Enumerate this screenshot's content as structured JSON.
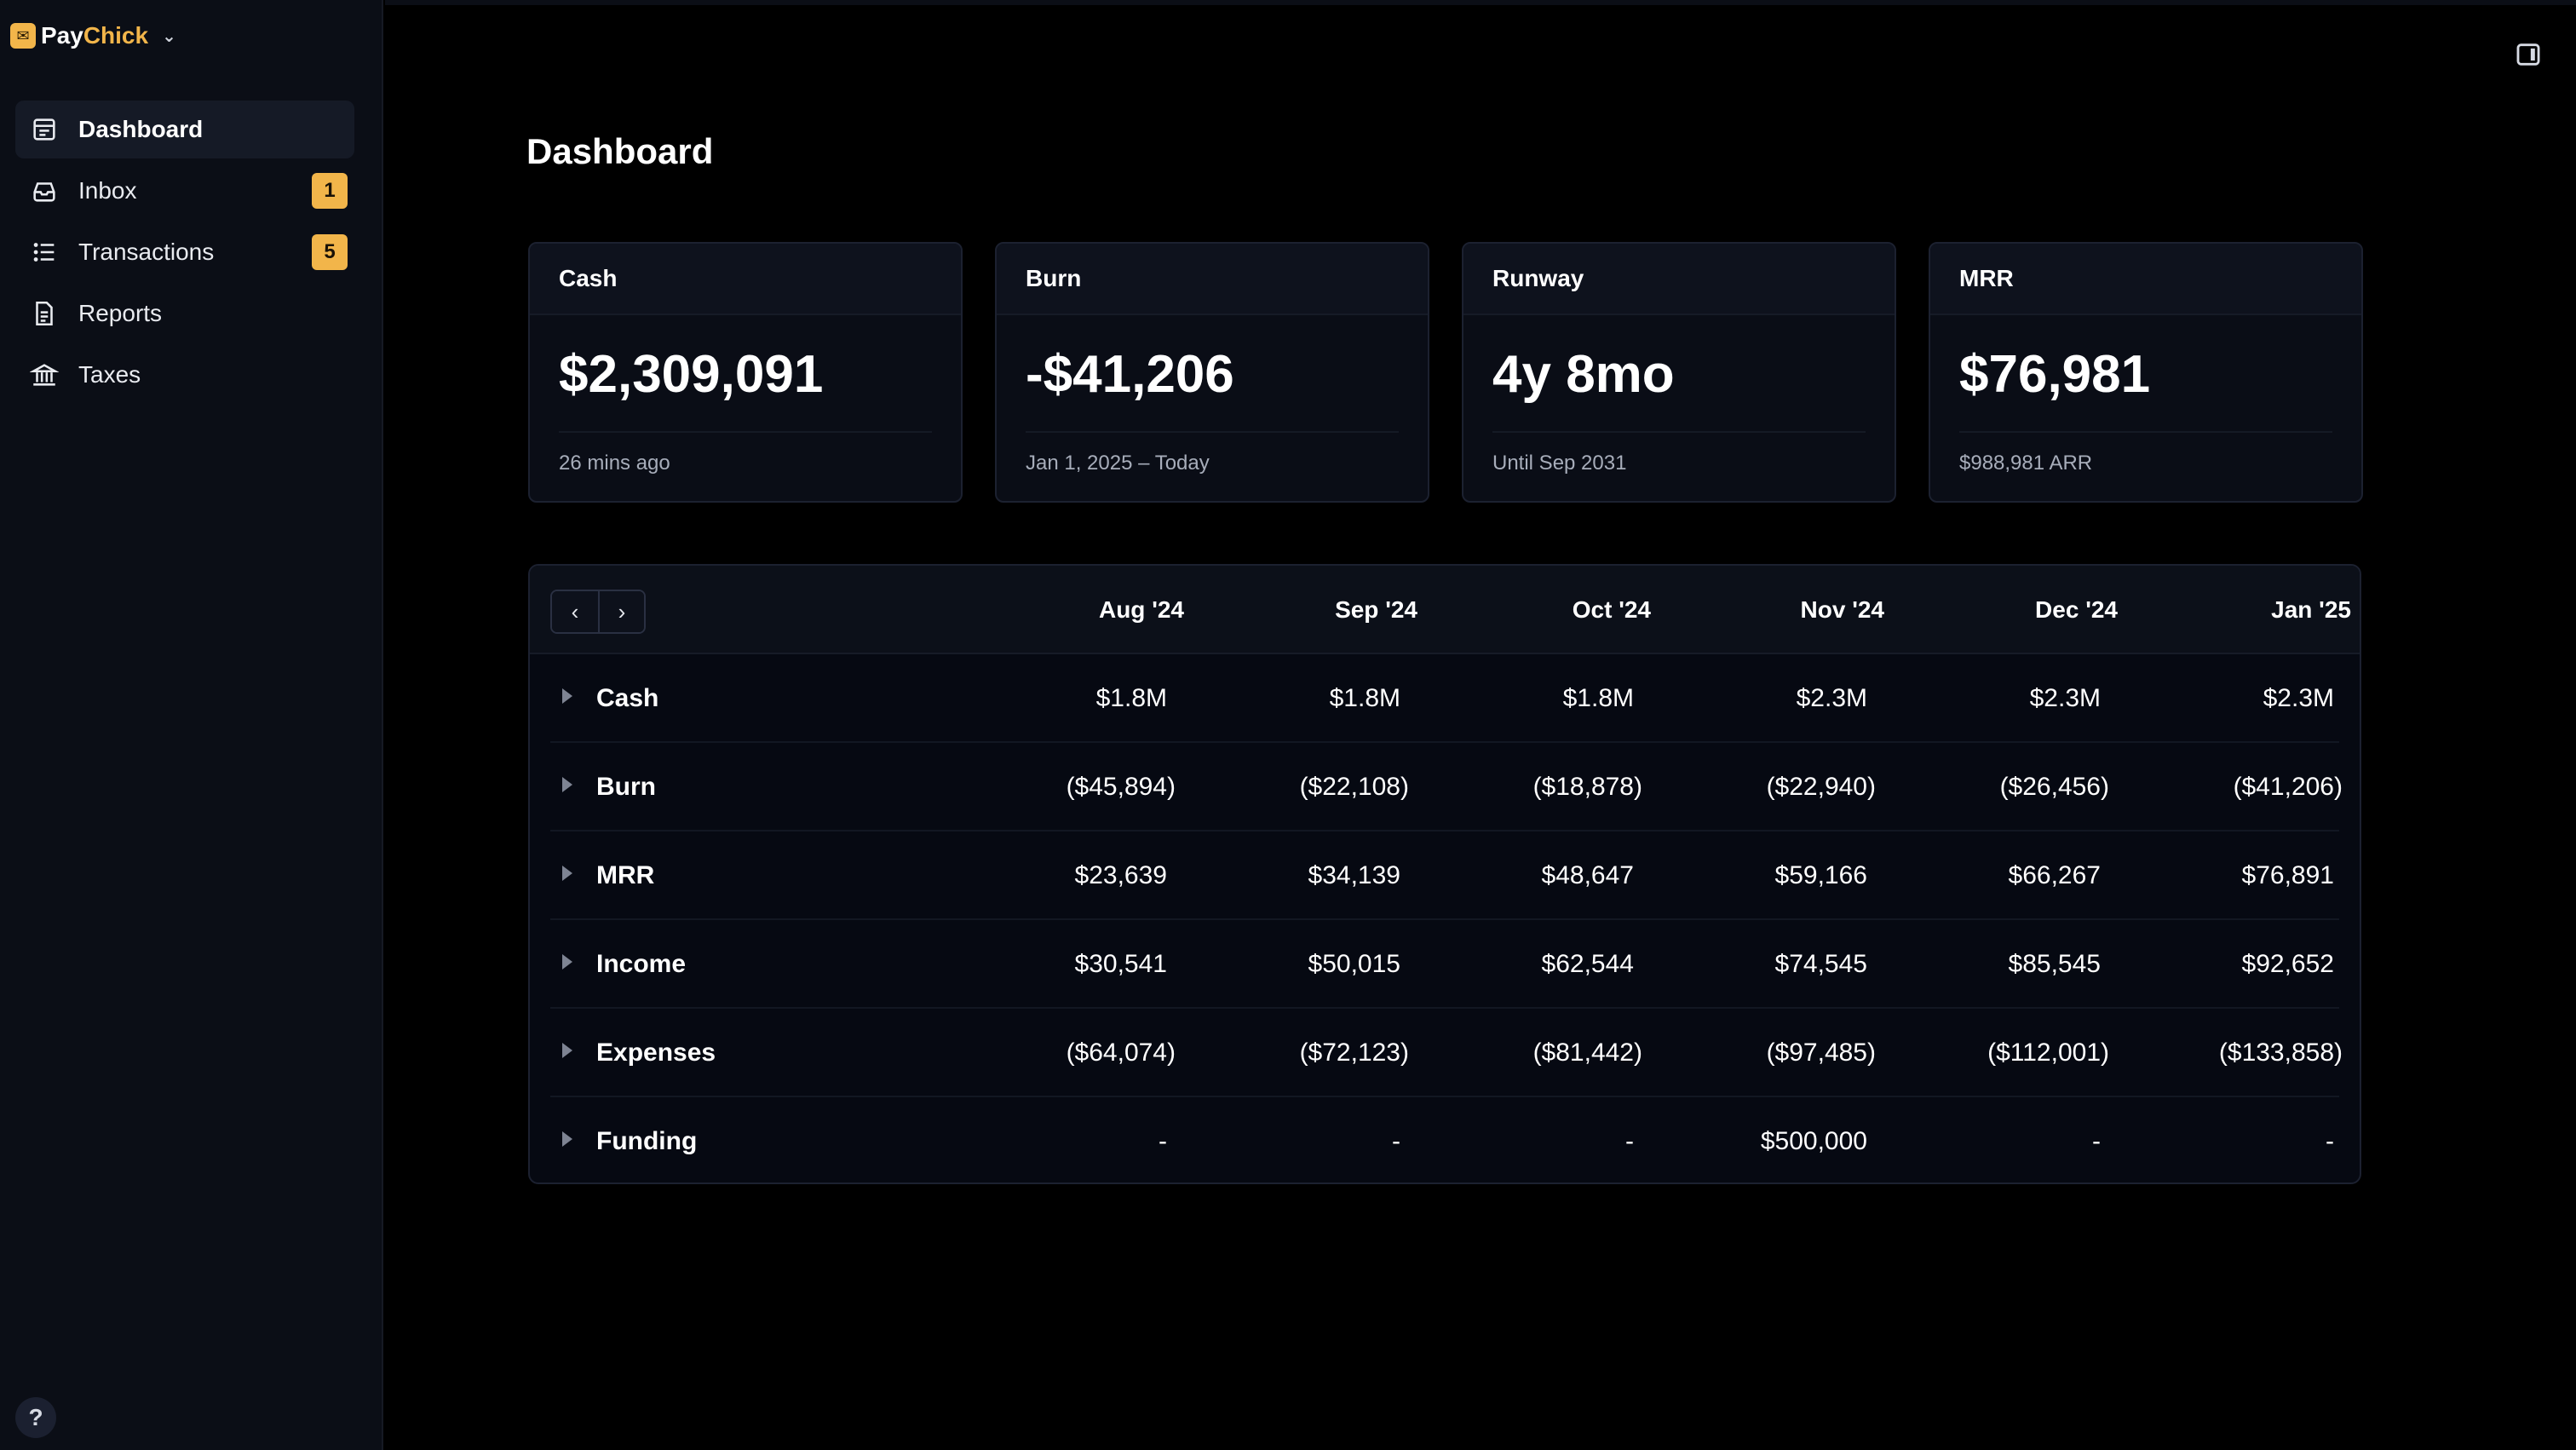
{
  "brand": {
    "name_part1": "Pay",
    "name_part2": "Chick"
  },
  "sidebar": {
    "items": [
      {
        "label": "Dashboard",
        "icon": "dashboard-icon",
        "active": true
      },
      {
        "label": "Inbox",
        "icon": "inbox-icon",
        "badge": "1"
      },
      {
        "label": "Transactions",
        "icon": "list-icon",
        "badge": "5"
      },
      {
        "label": "Reports",
        "icon": "document-icon"
      },
      {
        "label": "Taxes",
        "icon": "bank-icon"
      }
    ],
    "help_label": "?"
  },
  "page": {
    "title": "Dashboard"
  },
  "cards": [
    {
      "title": "Cash",
      "value": "$2,309,091",
      "sub": "26 mins ago"
    },
    {
      "title": "Burn",
      "value": "-$41,206",
      "sub": "Jan 1, 2025 – Today"
    },
    {
      "title": "Runway",
      "value": "4y 8mo",
      "sub": "Until Sep 2031"
    },
    {
      "title": "MRR",
      "value": "$76,981",
      "sub": "$988,981 ARR"
    }
  ],
  "table": {
    "pager": {
      "prev": "‹",
      "next": "›"
    },
    "columns": [
      "Aug '24",
      "Sep '24",
      "Oct '24",
      "Nov '24",
      "Dec '24",
      "Jan '25"
    ],
    "rows": [
      {
        "label": "Cash",
        "cells": [
          "$1.8M",
          "$1.8M",
          "$1.8M",
          "$2.3M",
          "$2.3M",
          "$2.3M"
        ]
      },
      {
        "label": "Burn",
        "cells": [
          "($45,894)",
          "($22,108)",
          "($18,878)",
          "($22,940)",
          "($26,456)",
          "($41,206)"
        ]
      },
      {
        "label": "MRR",
        "cells": [
          "$23,639",
          "$34,139",
          "$48,647",
          "$59,166",
          "$66,267",
          "$76,891"
        ]
      },
      {
        "label": "Income",
        "cells": [
          "$30,541",
          "$50,015",
          "$62,544",
          "$74,545",
          "$85,545",
          "$92,652"
        ]
      },
      {
        "label": "Expenses",
        "cells": [
          "($64,074)",
          "($72,123)",
          "($81,442)",
          "($97,485)",
          "($112,001)",
          "($133,858)"
        ]
      },
      {
        "label": "Funding",
        "cells": [
          "-",
          "-",
          "-",
          "$500,000",
          "-",
          "-"
        ]
      }
    ]
  },
  "colors": {
    "accent": "#f2b54a",
    "background": "#000000",
    "sidebar": "#0b0e16"
  }
}
